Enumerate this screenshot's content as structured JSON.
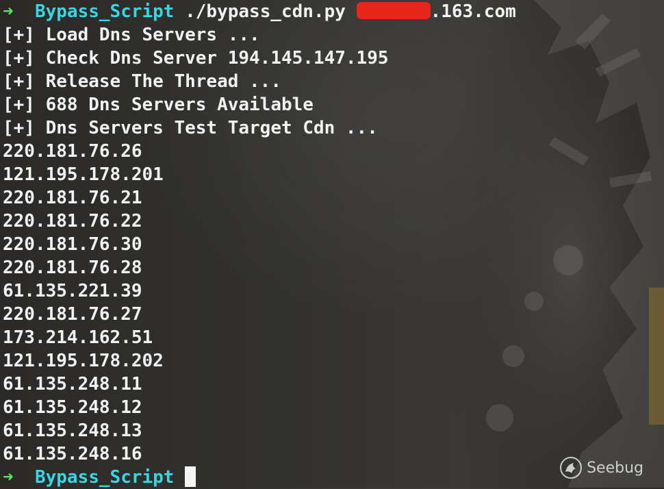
{
  "prompt": {
    "arrow": "➜",
    "directory": "Bypass_Script"
  },
  "command": {
    "program": "./bypass_cdn.py",
    "argument_suffix": ".163.com"
  },
  "output_lines": [
    "[+] Load Dns Servers ...",
    "[+] Check Dns Server 194.145.147.195",
    "[+] Release The Thread ...",
    "[+] 688 Dns Servers Available",
    "[+] Dns Servers Test Target Cdn ..."
  ],
  "ip_results": [
    "220.181.76.26",
    "121.195.178.201",
    "220.181.76.21",
    "220.181.76.22",
    "220.181.76.30",
    "220.181.76.28",
    "61.135.221.39",
    "220.181.76.27",
    "173.214.162.51",
    "121.195.178.202",
    "61.135.248.11",
    "61.135.248.12",
    "61.135.248.13",
    "61.135.248.16"
  ],
  "watermark": {
    "text": "Seebug",
    "icon": "seebug-logo-icon"
  },
  "colors": {
    "prompt_arrow": "#5fe35f",
    "prompt_dir": "#35d7e6",
    "text": "#f2f2f2",
    "redaction": "#e8261c"
  }
}
